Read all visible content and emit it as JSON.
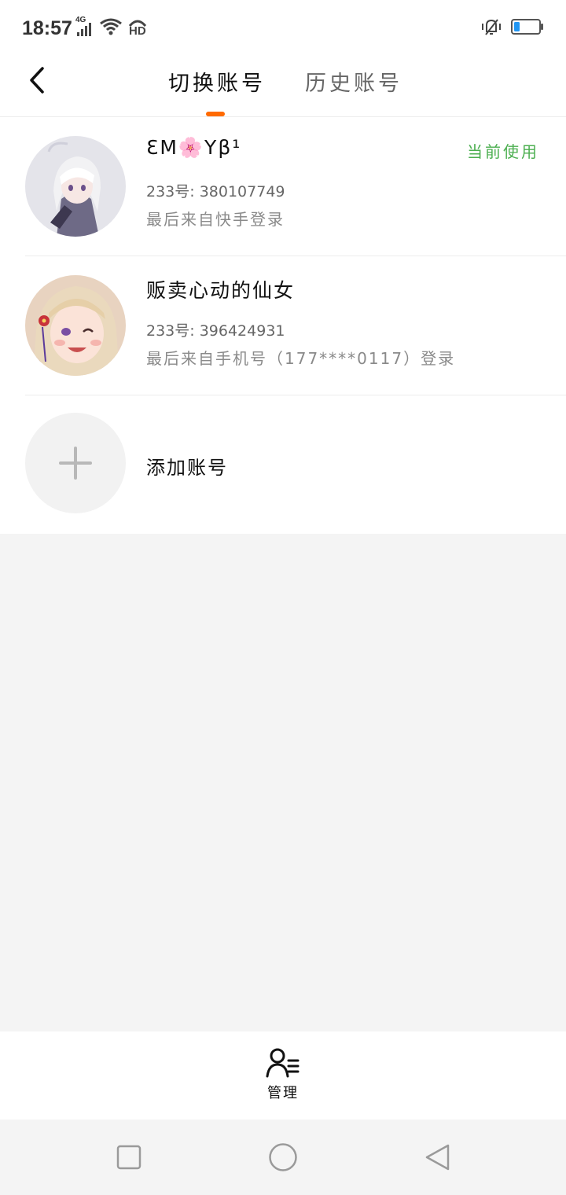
{
  "status_bar": {
    "time": "18:57",
    "network": "4G",
    "hd": "HD",
    "icons": [
      "signal-icon",
      "wifi-icon",
      "hd-call-icon",
      "vibrate-icon",
      "battery-icon"
    ],
    "battery_level": 0.2
  },
  "header": {
    "back_icon": "chevron-left-icon",
    "tabs": [
      {
        "label": "切换账号",
        "active": true
      },
      {
        "label": "历史账号",
        "active": false
      }
    ],
    "accent_color": "#ff6a00"
  },
  "accounts": [
    {
      "name": "ƐM🌸Yβ¹",
      "uid": "233号: 380107749",
      "last_login": "最后来自快手登录",
      "badge": "当前使用"
    },
    {
      "name": "贩卖心动的仙女",
      "uid": "233号: 396424931",
      "last_login": "最后来自手机号（177****0117）登录"
    }
  ],
  "add_account": {
    "label": "添加账号",
    "icon": "plus-icon"
  },
  "bottom_bar": {
    "manage_label": "管理",
    "manage_icon": "user-list-icon"
  },
  "system_nav": {
    "icons": [
      "recents-square-icon",
      "home-circle-icon",
      "back-triangle-icon"
    ]
  },
  "colors": {
    "accent": "#ff6a00",
    "current_badge": "#4caf50",
    "battery": "#2196f3"
  }
}
